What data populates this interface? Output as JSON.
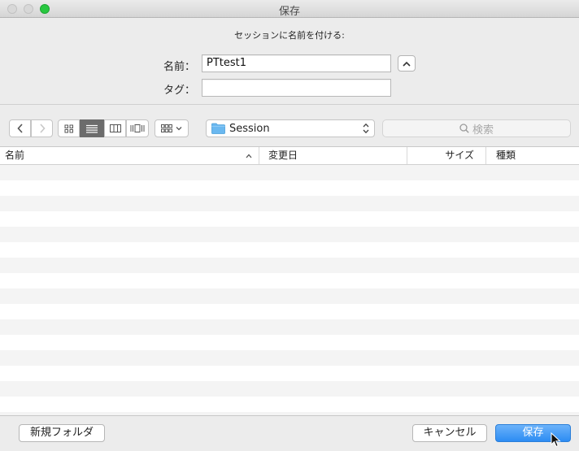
{
  "window": {
    "title": "保存"
  },
  "form": {
    "prompt": "セッションに名前を付ける:",
    "name_label": "名前：",
    "name_value": "PTtest1",
    "tags_label": "タグ：",
    "tags_value": ""
  },
  "toolbar": {
    "location": "Session",
    "search_placeholder": "検索"
  },
  "table": {
    "columns": [
      "名前",
      "変更日",
      "サイズ",
      "種類"
    ],
    "rows": []
  },
  "footer": {
    "new_folder": "新規フォルダ",
    "cancel": "キャンセル",
    "save": "保存"
  },
  "colors": {
    "primary": "#2c8cf3",
    "folder": "#6ab8f0"
  }
}
